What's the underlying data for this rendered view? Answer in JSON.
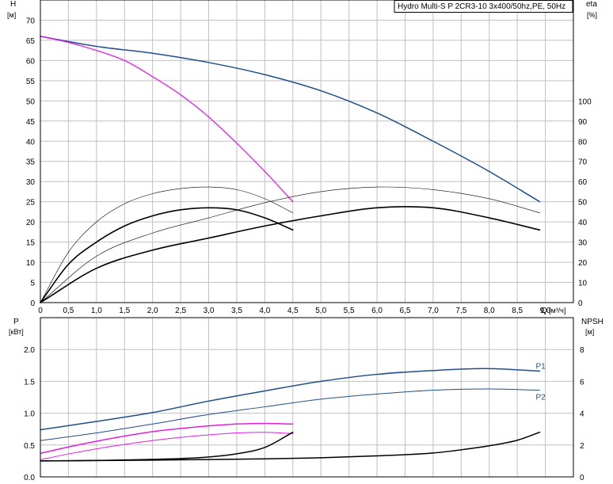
{
  "title": "Hydro Multi-S P 2CR3-10 3x400/50hz,PE, 50Hz",
  "colors": {
    "blue": "#1f4e8c",
    "magenta": "#e020e0",
    "black": "#000000",
    "grid": "#c0c0c0"
  },
  "labels": {
    "h_axis": "H",
    "h_unit": "[м]",
    "eta_axis": "eta",
    "eta_unit": "[%]",
    "q_axis": "Q",
    "q_unit": "[м³/ч]",
    "p_axis": "P",
    "p_unit": "[кВт]",
    "npsh_axis": "NPSH",
    "npsh_unit": "[м]"
  },
  "chart_data": [
    {
      "type": "line",
      "name": "head-efficiency",
      "x_range": [
        0,
        9.5
      ],
      "x_ticks": [
        "0",
        "0,5",
        "1,0",
        "1,5",
        "2,0",
        "2,5",
        "3,0",
        "3,5",
        "4,0",
        "4,5",
        "5,0",
        "5,5",
        "6,0",
        "6,5",
        "7,0",
        "7,5",
        "8,0",
        "8,5",
        "9,0"
      ],
      "y_range": [
        0,
        75
      ],
      "y_ticks": [
        "0",
        "5",
        "10",
        "15",
        "20",
        "25",
        "30",
        "35",
        "40",
        "45",
        "50",
        "55",
        "60",
        "65",
        "70"
      ],
      "y2_range": [
        0,
        150
      ],
      "y2_ticks": [
        "0",
        "10",
        "20",
        "30",
        "40",
        "50",
        "60",
        "70",
        "80",
        "90",
        "100"
      ],
      "grid": true,
      "series": [
        {
          "key": "head_blue",
          "axis": "y",
          "color": "#1f4e8c",
          "width": 1.5,
          "points": [
            [
              0,
              66
            ],
            [
              1,
              63.5
            ],
            [
              2,
              61.8
            ],
            [
              3,
              59.5
            ],
            [
              4,
              56.5
            ],
            [
              5,
              52.5
            ],
            [
              6,
              47
            ],
            [
              7,
              40
            ],
            [
              8,
              32.5
            ],
            [
              8.9,
              25
            ]
          ]
        },
        {
          "key": "head_magenta",
          "axis": "y",
          "color": "#e020e0",
          "width": 1.3,
          "points": [
            [
              0,
              66
            ],
            [
              0.5,
              64.5
            ],
            [
              1,
              62.5
            ],
            [
              1.5,
              60
            ],
            [
              2,
              56
            ],
            [
              2.5,
              51.5
            ],
            [
              3,
              46
            ],
            [
              3.5,
              39.5
            ],
            [
              4,
              32.5
            ],
            [
              4.5,
              25
            ]
          ]
        },
        {
          "key": "eta_full_a",
          "axis": "y2",
          "color": "#000000",
          "width": 0.6,
          "points": [
            [
              0,
              0
            ],
            [
              0.5,
              25
            ],
            [
              1,
              40
            ],
            [
              1.5,
              49
            ],
            [
              2,
              54
            ],
            [
              2.5,
              56.5
            ],
            [
              3,
              57.3
            ],
            [
              3.5,
              56
            ],
            [
              4,
              51.5
            ],
            [
              4.5,
              44.5
            ]
          ]
        },
        {
          "key": "eta_full_b",
          "axis": "y2",
          "color": "#000000",
          "width": 1.6,
          "dash_solid_from": 1.2,
          "points": [
            [
              0,
              0
            ],
            [
              0.5,
              19
            ],
            [
              1,
              30
            ],
            [
              1.5,
              38
            ],
            [
              2,
              43
            ],
            [
              2.5,
              46
            ],
            [
              3,
              47
            ],
            [
              3.5,
              46
            ],
            [
              4,
              42
            ],
            [
              4.5,
              36
            ]
          ]
        },
        {
          "key": "eta_part_a",
          "axis": "y2",
          "color": "#000000",
          "width": 0.6,
          "points": [
            [
              0,
              0
            ],
            [
              1,
              23
            ],
            [
              2,
              34.5
            ],
            [
              3,
              42
            ],
            [
              4,
              49.5
            ],
            [
              5,
              55
            ],
            [
              6,
              57.3
            ],
            [
              7,
              56
            ],
            [
              8,
              51.5
            ],
            [
              8.9,
              44.5
            ]
          ]
        },
        {
          "key": "eta_part_b",
          "axis": "y2",
          "color": "#000000",
          "width": 1.6,
          "dash_solid_from": 2.4,
          "points": [
            [
              0,
              0
            ],
            [
              1,
              17
            ],
            [
              2,
              26
            ],
            [
              3,
              32
            ],
            [
              4,
              38
            ],
            [
              5,
              43
            ],
            [
              6,
              47
            ],
            [
              7,
              47
            ],
            [
              8,
              42
            ],
            [
              8.9,
              36
            ]
          ]
        }
      ]
    },
    {
      "type": "line",
      "name": "power-npsh",
      "x_range": [
        0,
        9.5
      ],
      "y_range": [
        0,
        2.5
      ],
      "y_ticks": [
        "0.0",
        "0.5",
        "1.0",
        "1.5",
        "2.0"
      ],
      "y2_range": [
        0,
        10
      ],
      "y2_ticks": [
        "0",
        "2",
        "4",
        "6",
        "8"
      ],
      "grid": true,
      "series": [
        {
          "key": "P1",
          "name": "P1",
          "axis": "y",
          "color": "#1f4e8c",
          "width": 1.5,
          "points": [
            [
              0,
              0.74
            ],
            [
              1,
              0.87
            ],
            [
              2,
              1.01
            ],
            [
              3,
              1.19
            ],
            [
              4,
              1.35
            ],
            [
              5,
              1.5
            ],
            [
              6,
              1.61
            ],
            [
              7,
              1.67
            ],
            [
              8,
              1.7
            ],
            [
              8.9,
              1.66
            ]
          ]
        },
        {
          "key": "P2",
          "name": "P2",
          "axis": "y",
          "color": "#1f4e8c",
          "width": 1,
          "points": [
            [
              0,
              0.57
            ],
            [
              1,
              0.69
            ],
            [
              2,
              0.83
            ],
            [
              3,
              0.98
            ],
            [
              4,
              1.1
            ],
            [
              5,
              1.22
            ],
            [
              6,
              1.3
            ],
            [
              7,
              1.36
            ],
            [
              8,
              1.38
            ],
            [
              8.9,
              1.36
            ]
          ]
        },
        {
          "key": "P1_part",
          "axis": "y",
          "color": "#e020e0",
          "width": 1.5,
          "points": [
            [
              0,
              0.37
            ],
            [
              0.5,
              0.47
            ],
            [
              1,
              0.56
            ],
            [
              1.5,
              0.64
            ],
            [
              2,
              0.71
            ],
            [
              2.5,
              0.76
            ],
            [
              3,
              0.8
            ],
            [
              3.5,
              0.83
            ],
            [
              4,
              0.84
            ],
            [
              4.5,
              0.83
            ]
          ]
        },
        {
          "key": "P2_part",
          "axis": "y",
          "color": "#e020e0",
          "width": 1,
          "points": [
            [
              0,
              0.27
            ],
            [
              0.5,
              0.36
            ],
            [
              1,
              0.44
            ],
            [
              1.5,
              0.51
            ],
            [
              2,
              0.57
            ],
            [
              2.5,
              0.62
            ],
            [
              3,
              0.66
            ],
            [
              3.5,
              0.69
            ],
            [
              4,
              0.7
            ],
            [
              4.5,
              0.68
            ]
          ]
        },
        {
          "key": "npsh_part",
          "axis": "y2",
          "color": "#000000",
          "width": 1.5,
          "points": [
            [
              0,
              1
            ],
            [
              1,
              1.03
            ],
            [
              2,
              1.1
            ],
            [
              2.5,
              1.15
            ],
            [
              3,
              1.25
            ],
            [
              3.5,
              1.45
            ],
            [
              4,
              1.85
            ],
            [
              4.5,
              2.8
            ]
          ]
        },
        {
          "key": "npsh_full",
          "axis": "y2",
          "color": "#000000",
          "width": 1.5,
          "points": [
            [
              0,
              1
            ],
            [
              2,
              1.05
            ],
            [
              4,
              1.13
            ],
            [
              5,
              1.2
            ],
            [
              6,
              1.32
            ],
            [
              7,
              1.5
            ],
            [
              7.5,
              1.7
            ],
            [
              8,
              1.95
            ],
            [
              8.5,
              2.3
            ],
            [
              8.9,
              2.8
            ]
          ]
        }
      ]
    }
  ]
}
